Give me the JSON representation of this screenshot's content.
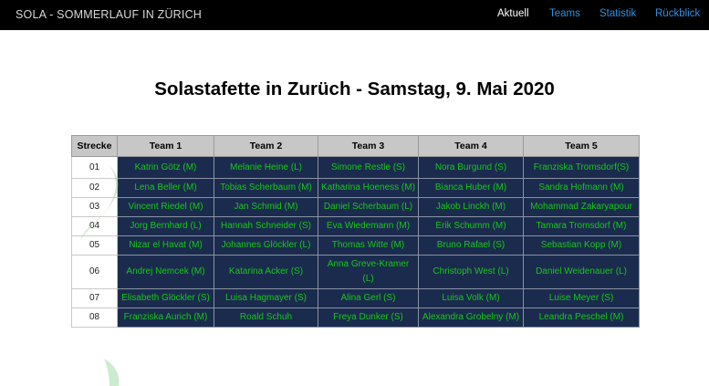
{
  "navbar": {
    "brand": "SOLA - SOMMERLAUF IN ZÜRICH",
    "links": [
      {
        "label": "Aktuell",
        "color": "#ffffff"
      },
      {
        "label": "Teams",
        "color": "#2f8fe0"
      },
      {
        "label": "Statistik",
        "color": "#2f8fe0"
      },
      {
        "label": "Rückblick",
        "color": "#2f8fe0"
      }
    ]
  },
  "page": {
    "title": "Solastafette in Zurüch - Samstag, 9. Mai 2020"
  },
  "table": {
    "headers": [
      "Strecke",
      "Team 1",
      "Team 2",
      "Team 3",
      "Team 4",
      "Team 5"
    ],
    "rows": [
      {
        "leg": "01",
        "cells": [
          "Katrin Götz (M)",
          "Melanie Heine (L)",
          "Simone Restle (S)",
          "Nora Burgund (S)",
          "Franziska Tromsdorf(S)"
        ]
      },
      {
        "leg": "02",
        "cells": [
          "Lena Beller (M)",
          "Tobias Scherbaum (M)",
          "Katharina Hoeness (M)",
          "Bianca Huber (M)",
          "Sandra Hofmann (M)"
        ]
      },
      {
        "leg": "03",
        "cells": [
          "Vincent Riedel (M)",
          "Jan Schmid (M)",
          "Daniel Scherbaum (L)",
          "Jakob Linckh (M)",
          "Mohammad Zakaryapour"
        ]
      },
      {
        "leg": "04",
        "cells": [
          "Jorg Bernhard (L)",
          "Hannah Schneider (S)",
          "Eva Wiedemann (M)",
          "Erik Schumm (M)",
          "Tamara Tromsdorf (M)"
        ]
      },
      {
        "leg": "05",
        "cells": [
          "Nizar el Havat (M)",
          "Johannes Glöckler (L)",
          "Thomas Witte (M)",
          "Bruno Rafael (S)",
          "Sebastian Kopp (M)"
        ]
      },
      {
        "leg": "06",
        "cells": [
          "Andrej Nemcek (M)",
          "Katarina Acker (S)",
          "Anna Greve-Kramer (L)",
          "Christoph West (L)",
          "Daniel Weidenauer (L)"
        ]
      },
      {
        "leg": "07",
        "cells": [
          "Elisabeth Glöckler (S)",
          "Luisa Hagmayer (S)",
          "Alina Gerl (S)",
          "Luisa Volk (M)",
          "Luise Meyer (S)"
        ]
      },
      {
        "leg": "08",
        "cells": [
          "Franziska Aurich (M)",
          "Roald Schuh",
          "Freya Dunker (S)",
          "Alexandra Grobelny (M)",
          "Leandra Peschel (M)"
        ]
      }
    ]
  },
  "colors": {
    "navbar_bg": "#000000",
    "cell_bg": "#1a2b4d",
    "cell_text": "#17c817",
    "header_bg": "#c7c7c7",
    "link_active": "#ffffff",
    "link": "#2f8fe0"
  }
}
